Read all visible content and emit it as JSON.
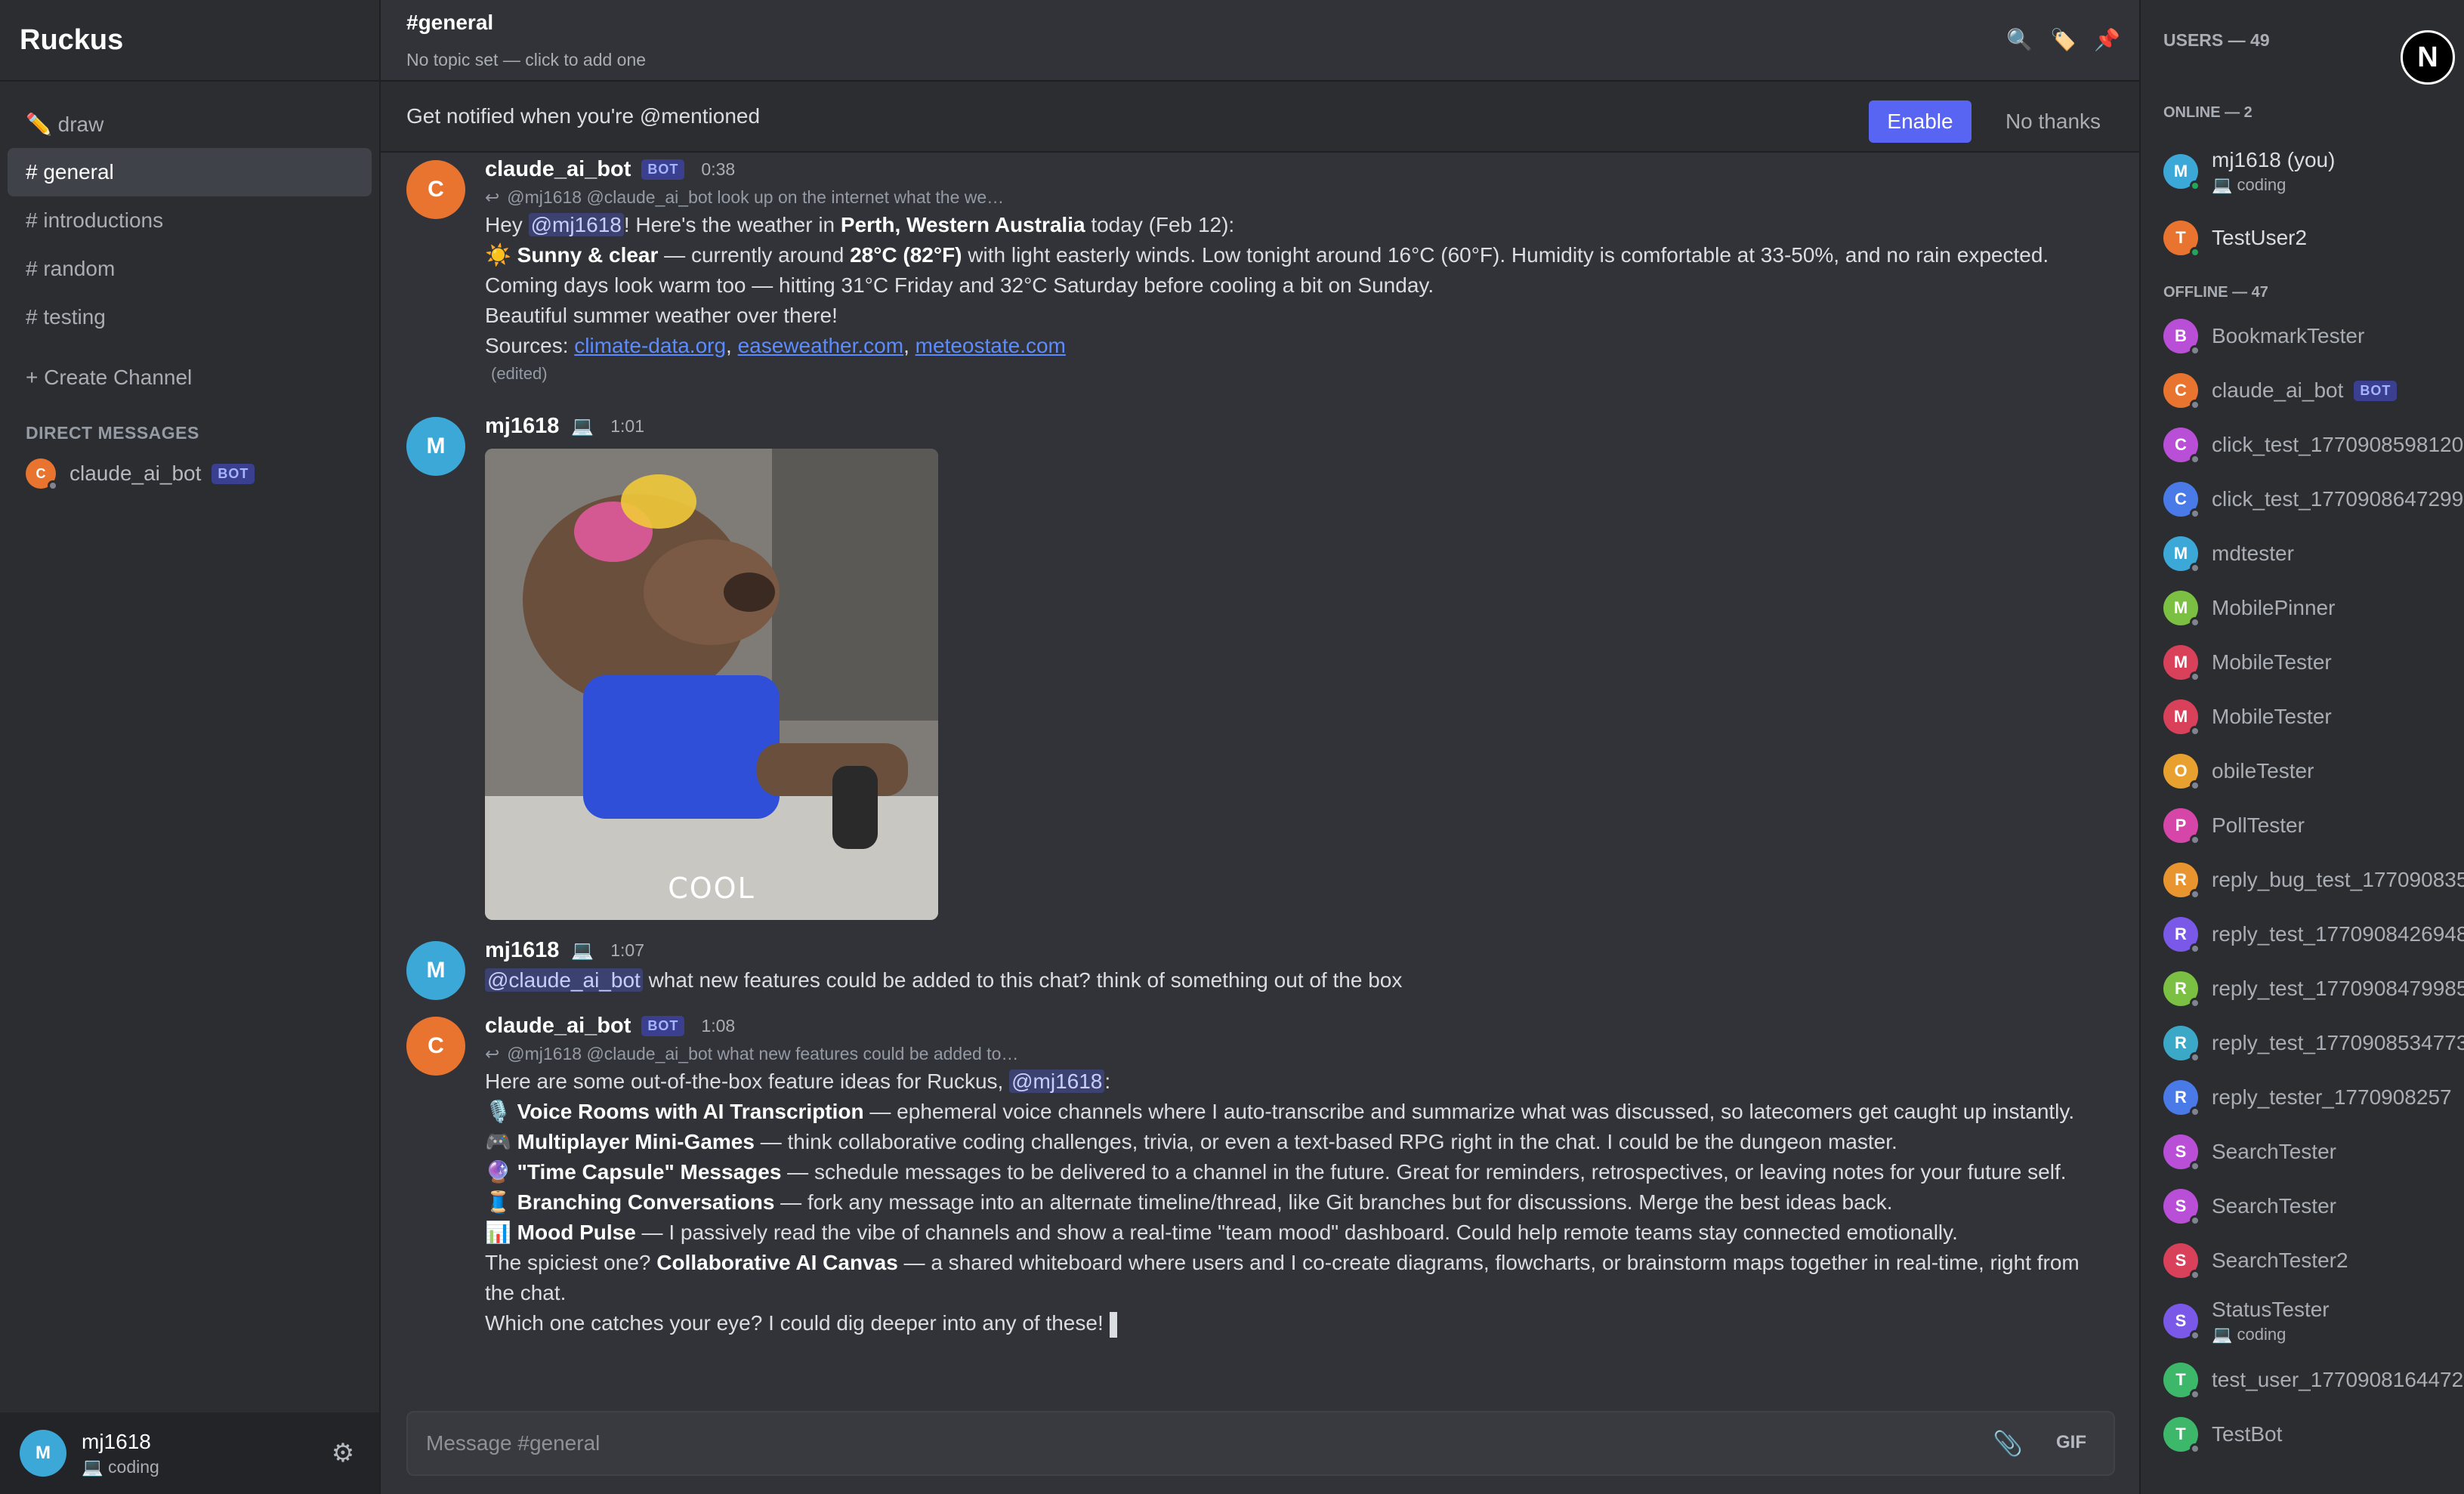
{
  "server": {
    "name": "Ruckus"
  },
  "channels": [
    {
      "label": "✏️ draw"
    },
    {
      "label": "# general"
    },
    {
      "label": "# introductions"
    },
    {
      "label": "# random"
    },
    {
      "label": "# testing"
    }
  ],
  "create_channel": "+ Create Channel",
  "direct_messages": {
    "header": "DIRECT MESSAGES",
    "items": [
      {
        "initial": "C",
        "name": "claude_ai_bot",
        "badge": "BOT"
      }
    ]
  },
  "current_user": {
    "initial": "M",
    "name": "mj1618",
    "status": "💻 coding"
  },
  "header": {
    "channel": "#general",
    "topic": "No topic set — click to add one"
  },
  "notify": {
    "text": "Get notified when you're @mentioned",
    "enable": "Enable",
    "dismiss": "No thanks"
  },
  "messages": [
    {
      "initial": "C",
      "author": "claude_ai_bot",
      "badge": "BOT",
      "time": "0:38",
      "reply": "@mj1618 @claude_ai_bot look up on the internet what the we…",
      "lines": {
        "l1a": "Hey ",
        "l1m": "@mj1618",
        "l1b": "! Here's the weather in ",
        "l1c": "Perth, Western Australia",
        "l1d": " today (Feb 12):",
        "l2a": "☀️ ",
        "l2b": "Sunny & clear",
        "l2c": " — currently around ",
        "l2d": "28°C (82°F)",
        "l2e": " with light easterly winds. Low tonight around 16°C (60°F). Humidity is comfortable at 33-50%, and no rain expected.",
        "l3": "Coming days look warm too — hitting 31°C Friday and 32°C Saturday before cooling a bit on Sunday.",
        "l4": "Beautiful summer weather over there!",
        "l5a": "Sources: ",
        "l5b": "climate-data.org",
        "l5c": ", ",
        "l5d": "easeweather.com",
        "l5e": ", ",
        "l5f": "meteostate.com"
      },
      "edited": "(edited)"
    },
    {
      "initial": "M",
      "author": "mj1618",
      "status_icon": "💻",
      "time": "1:01",
      "gif_caption": "COOL"
    },
    {
      "initial": "M",
      "author": "mj1618",
      "status_icon": "💻",
      "time": "1:07",
      "mention": "@claude_ai_bot",
      "text": " what new features could be added to this chat? think of something out of the box"
    },
    {
      "initial": "C",
      "author": "claude_ai_bot",
      "badge": "BOT",
      "time": "1:08",
      "reply": "@mj1618 @claude_ai_bot what new features could be added to…",
      "lines": {
        "intro_a": "Here are some out-of-the-box feature ideas for Ruckus, ",
        "intro_m": "@mj1618",
        "intro_b": ":",
        "f1i": "🎙️ ",
        "f1b": "Voice Rooms with AI Transcription",
        "f1t": " — ephemeral voice channels where I auto-transcribe and summarize what was discussed, so latecomers get caught up instantly.",
        "f2i": "🎮 ",
        "f2b": "Multiplayer Mini-Games",
        "f2t": " — think collaborative coding challenges, trivia, or even a text-based RPG right in the chat. I could be the dungeon master.",
        "f3i": "🔮 ",
        "f3b": "\"Time Capsule\" Messages",
        "f3t": " — schedule messages to be delivered to a channel in the future. Great for reminders, retrospectives, or leaving notes for your future self.",
        "f4i": "🧵 ",
        "f4b": "Branching Conversations",
        "f4t": " — fork any message into an alternate timeline/thread, like Git branches but for discussions. Merge the best ideas back.",
        "f5i": "📊 ",
        "f5b": "Mood Pulse",
        "f5t": " — I passively read the vibe of channels and show a real-time \"team mood\" dashboard. Could help remote teams stay connected emotionally.",
        "s1a": "The spiciest one? ",
        "s1b": "Collaborative AI Canvas",
        "s1c": " — a shared whiteboard where users and I co-create diagrams, flowcharts, or brainstorm maps together in real-time, right from",
        "s2": "the chat.",
        "s3": "Which one catches your eye? I could dig deeper into any of these!"
      }
    }
  ],
  "composer": {
    "placeholder": "Message #general",
    "gif": "GIF"
  },
  "members_panel": {
    "title": "USERS — 49",
    "logo": "N",
    "online_label": "ONLINE — 2",
    "offline_label": "OFFLINE — 47",
    "online": [
      {
        "initial": "M",
        "name": "mj1618 (you)",
        "status": "💻 coding",
        "color": "#3ba8d8"
      },
      {
        "initial": "T",
        "name": "TestUser2",
        "color": "#e8742f"
      }
    ],
    "offline": [
      {
        "initial": "B",
        "name": "BookmarkTester",
        "color": "#b84fd6"
      },
      {
        "initial": "C",
        "name": "claude_ai_bot",
        "badge": "BOT",
        "color": "#e8742f"
      },
      {
        "initial": "C",
        "name": "click_test_1770908598120",
        "color": "#b84fd6"
      },
      {
        "initial": "C",
        "name": "click_test_1770908647299",
        "color": "#4a7ae8"
      },
      {
        "initial": "M",
        "name": "mdtester",
        "color": "#3ba8d8"
      },
      {
        "initial": "M",
        "name": "MobilePinner",
        "color": "#7bc043"
      },
      {
        "initial": "M",
        "name": "MobileTester",
        "color": "#d9405a"
      },
      {
        "initial": "M",
        "name": "MobileTester",
        "color": "#d9405a"
      },
      {
        "initial": "O",
        "name": "obileTester",
        "color": "#e8a12f"
      },
      {
        "initial": "P",
        "name": "PollTester",
        "color": "#d646a8"
      },
      {
        "initial": "R",
        "name": "reply_bug_test_177090835",
        "color": "#e8942f"
      },
      {
        "initial": "R",
        "name": "reply_test_1770908426948",
        "color": "#7a58e8"
      },
      {
        "initial": "R",
        "name": "reply_test_1770908479985",
        "color": "#7bc043"
      },
      {
        "initial": "R",
        "name": "reply_test_1770908534773",
        "color": "#3ba8c8"
      },
      {
        "initial": "R",
        "name": "reply_tester_1770908257",
        "color": "#4a7ae8"
      },
      {
        "initial": "S",
        "name": "SearchTester",
        "color": "#b84fd6"
      },
      {
        "initial": "S",
        "name": "SearchTester",
        "color": "#b84fd6"
      },
      {
        "initial": "S",
        "name": "SearchTester2",
        "color": "#d9405a"
      },
      {
        "initial": "S",
        "name": "StatusTester",
        "status": "💻 coding",
        "color": "#7a58e8"
      },
      {
        "initial": "T",
        "name": "test_user_1770908164472",
        "color": "#3db86a"
      },
      {
        "initial": "T",
        "name": "TestBot",
        "color": "#3db86a"
      }
    ]
  },
  "colors": {
    "accent": "#5865f2",
    "online": "#23a55a",
    "offline": "#80848e",
    "bot_orange": "#e8742f",
    "user_blue": "#3ba8d8"
  }
}
